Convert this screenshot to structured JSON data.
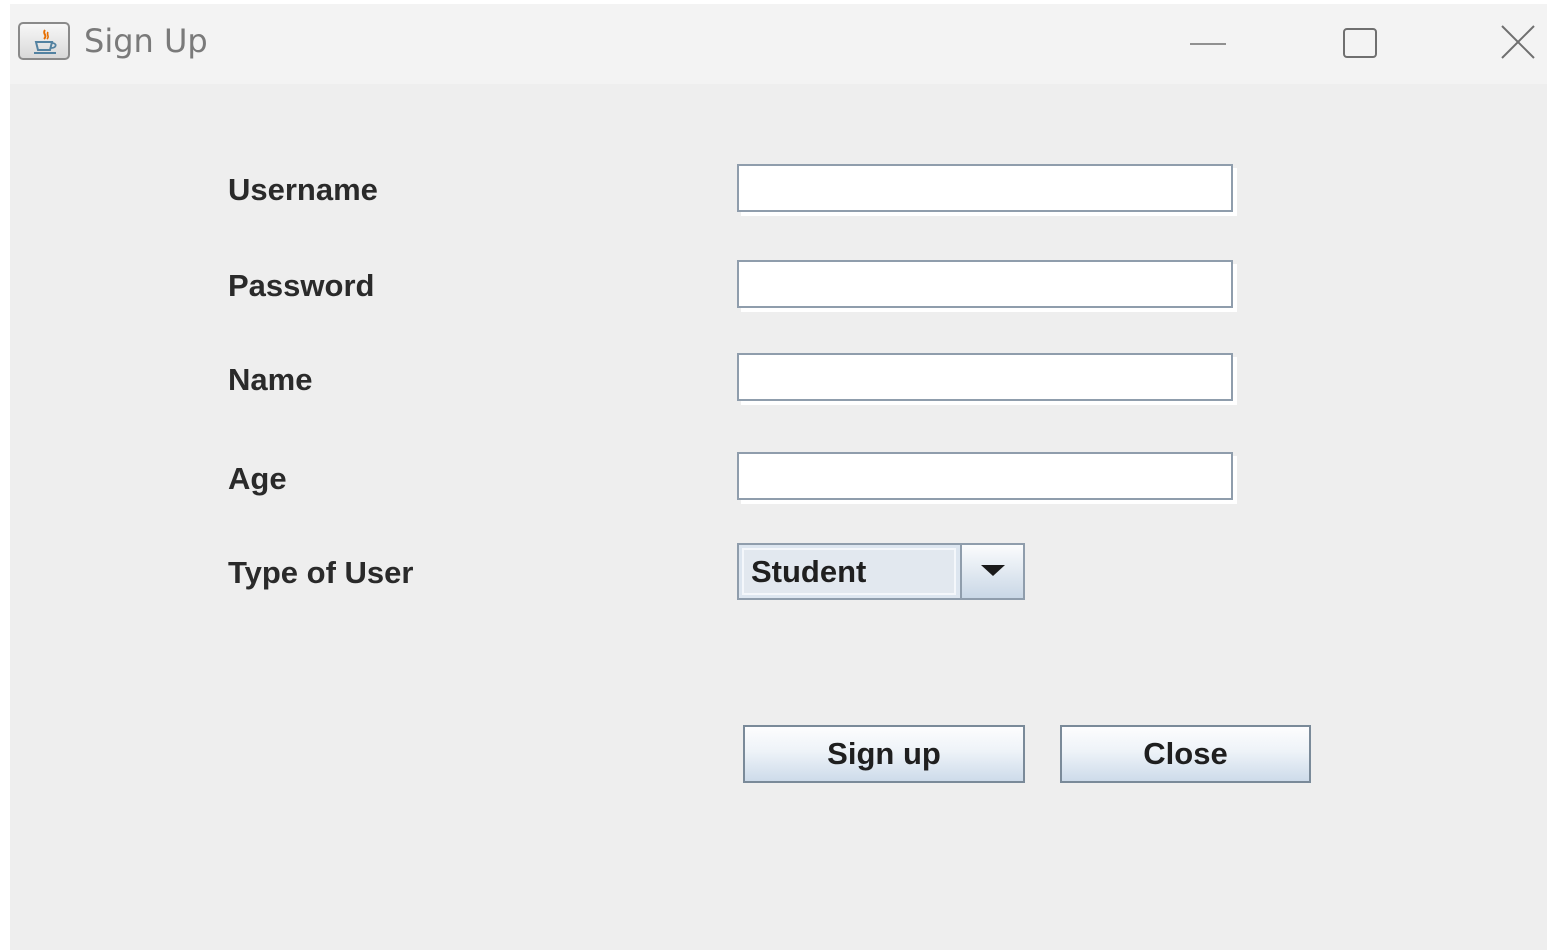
{
  "window": {
    "title": "Sign Up",
    "app_icon": "java-coffee-cup-icon",
    "controls": {
      "minimize_icon": "minimize-icon",
      "maximize_icon": "maximize-icon",
      "close_icon": "close-icon"
    }
  },
  "form": {
    "username": {
      "label": "Username",
      "value": ""
    },
    "password": {
      "label": "Password",
      "value": ""
    },
    "name": {
      "label": "Name",
      "value": ""
    },
    "age": {
      "label": "Age",
      "value": ""
    },
    "user_type": {
      "label": "Type of User",
      "selected": "Student",
      "arrow_icon": "chevron-down-icon"
    }
  },
  "buttons": {
    "signup_label": "Sign up",
    "close_label": "Close"
  },
  "colors": {
    "background": "#eeeeee",
    "titlebar": "#f3f3f3",
    "field_border": "#8f9dac",
    "button_gradient_bottom": "#cddbea"
  }
}
